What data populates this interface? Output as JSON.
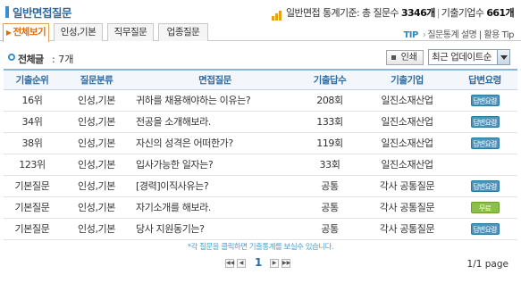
{
  "header": {
    "title": "일반면접질문",
    "stats_label": "일반면접 통계기준: 총 질문수",
    "question_count": "3346개",
    "company_label": "기출기업수",
    "company_count": "661개"
  },
  "tabs": [
    {
      "label": "전체보기",
      "active": true
    },
    {
      "label": "인성,기본",
      "active": false
    },
    {
      "label": "직무질문",
      "active": false
    },
    {
      "label": "업종질문",
      "active": false
    }
  ],
  "tip": {
    "label": "TIP",
    "link1": "질문통계 설명",
    "separator": "|",
    "link2": "활용 Tip"
  },
  "summary": {
    "total_label": "전체글",
    "total_value": ": 7개",
    "print_label": "인쇄",
    "sort_selected": "최근 업데이트순"
  },
  "table": {
    "headers": [
      "기출순위",
      "질문분류",
      "면접질문",
      "기출답수",
      "기출기업",
      "답변요령"
    ],
    "rows": [
      {
        "rank": "16위",
        "category": "인성,기본",
        "question": "귀하를 채용해야하는 이유는?",
        "count": "208회",
        "company": "일진소재산업",
        "answer": "답변요령",
        "answer_color": "blue"
      },
      {
        "rank": "34위",
        "category": "인성,기본",
        "question": "전공을 소개해보라.",
        "count": "133회",
        "company": "일진소재산업",
        "answer": "답변요령",
        "answer_color": "blue"
      },
      {
        "rank": "38위",
        "category": "인성,기본",
        "question": "자신의 성격은 어떠한가?",
        "count": "119회",
        "company": "일진소재산업",
        "answer": "답변요령",
        "answer_color": "blue"
      },
      {
        "rank": "123위",
        "category": "인성,기본",
        "question": "입사가능한 일자는?",
        "count": "33회",
        "company": "일진소재산업",
        "answer": "",
        "answer_color": ""
      },
      {
        "rank": "기본질문",
        "category": "인성,기본",
        "question": "[경력]이직사유는?",
        "count": "공통",
        "company": "각사 공통질문",
        "answer": "답변요령",
        "answer_color": "blue"
      },
      {
        "rank": "기본질문",
        "category": "인성,기본",
        "question": "자기소개를 해보라.",
        "count": "공통",
        "company": "각사 공통질문",
        "answer": "무료",
        "answer_color": "green"
      },
      {
        "rank": "기본질문",
        "category": "인성,기본",
        "question": "당사 지원동기는?",
        "count": "공통",
        "company": "각사 공통질문",
        "answer": "답변요령",
        "answer_color": "blue"
      }
    ]
  },
  "footnote": "*각 질문을 클릭하면 기출통계를 보실수 있습니다.",
  "pagination": {
    "current_page": "1",
    "page_info": "1/1 page"
  },
  "colors": {
    "accent": "#2b6aa3",
    "active_tab": "#e56a00",
    "answer_blue": "#4d95bd",
    "answer_green": "#8cbf4a"
  }
}
